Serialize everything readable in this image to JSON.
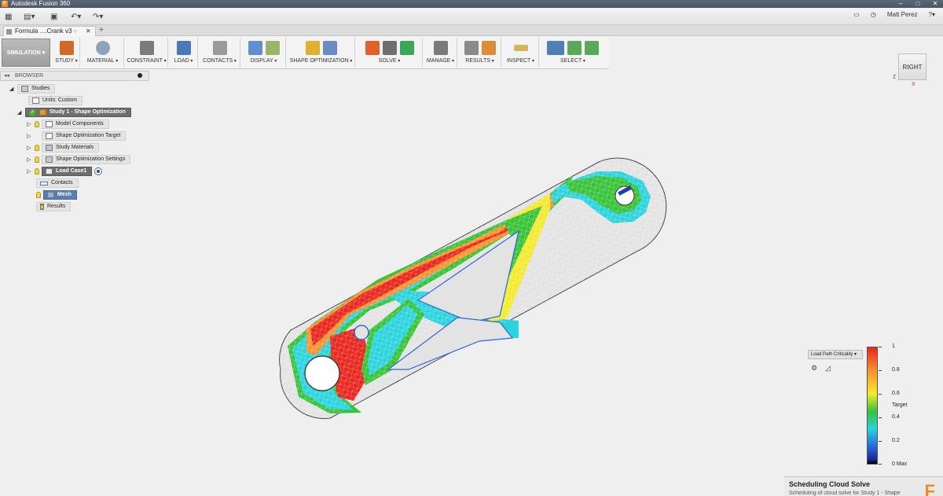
{
  "window": {
    "title": "Autodesk Fusion 360"
  },
  "qat": {
    "user_name": "Matt Perez"
  },
  "document_tab": {
    "name": "Formula ....Crank v3"
  },
  "ribbon": {
    "workspace": "SIMULATION",
    "groups": [
      "STUDY",
      "MATERIAL",
      "CONSTRAINT",
      "LOAD",
      "CONTACTS",
      "DISPLAY",
      "SHAPE OPTIMIZATION",
      "SOLVE",
      "MANAGE",
      "RESULTS",
      "INSPECT",
      "SELECT"
    ]
  },
  "browser": {
    "title": "BROWSER",
    "root": "Studies",
    "units": "Units: Custom",
    "study": "Study 1 - Shape Optimization",
    "items": [
      "Model Components",
      "Shape Optimization Target",
      "Study Materials",
      "Shape Optimization Settings"
    ],
    "load_case": "Load Case1",
    "contacts": "Contacts",
    "mesh": "Mesh",
    "results": "Results"
  },
  "viewcube": {
    "face": "RIGHT",
    "axis_z": "Z",
    "axis_x": "X"
  },
  "legend": {
    "dropdown": "Load Path Criticality",
    "labels": [
      "1",
      "0.8",
      "0.6",
      "Target",
      "0.4",
      "0.2",
      "0 Max"
    ]
  },
  "toast": {
    "title": "Scheduling Cloud Solve",
    "message": "Scheduling of cloud solve for Study 1 - Shape"
  },
  "colors": {
    "critical": "#e8261d",
    "high": "#f7932d",
    "mid": "#f3ea2e",
    "green": "#37c337",
    "cyan": "#2ad3dd",
    "blue": "#2a6ad8",
    "part_fill": "#e3e3e3",
    "fusion_orange": "#f08a24"
  }
}
